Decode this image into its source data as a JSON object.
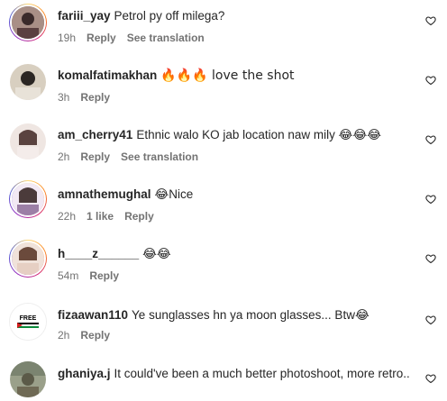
{
  "comments": [
    {
      "username": "fariii_yay",
      "text": "Petrol py off milega?",
      "time": "19h",
      "reply": "Reply",
      "translate": "See translation",
      "likes": ""
    },
    {
      "username": "komalfatimakhan",
      "text": "🔥🔥🔥 love the shot",
      "time": "3h",
      "reply": "Reply",
      "translate": "",
      "likes": ""
    },
    {
      "username": "am_cherry41",
      "text": "Ethnic walo KO jab location naw mily 😂😂😂",
      "time": "2h",
      "reply": "Reply",
      "translate": "See translation",
      "likes": ""
    },
    {
      "username": "amnathemughal",
      "text": "😂Nice",
      "time": "22h",
      "reply": "Reply",
      "translate": "",
      "likes": "1 like"
    },
    {
      "username": "h____z______",
      "text": "😂😂",
      "time": "54m",
      "reply": "Reply",
      "translate": "",
      "likes": ""
    },
    {
      "username": "fizaawan110",
      "text": "Ye sunglasses hn ya moon glasses... Btw😂",
      "time": "2h",
      "reply": "Reply",
      "translate": "",
      "likes": "",
      "avatar_text": "FREE PALESTINE"
    },
    {
      "username": "ghaniya.j",
      "text": "It could've been a much better photoshoot, more retro..",
      "time": "",
      "reply": "",
      "translate": "",
      "likes": ""
    }
  ],
  "colors": {
    "text": "#262626",
    "muted": "#737373",
    "story_ring": "#d62976"
  }
}
